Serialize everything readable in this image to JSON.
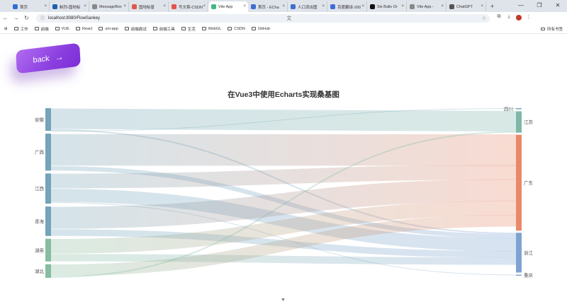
{
  "browser": {
    "tabs": [
      {
        "label": "首页",
        "color": "#2f6fd6"
      },
      {
        "label": "制剂-国地标",
        "color": "#1a5fb4"
      },
      {
        "label": "MessageBox",
        "color": "#888888"
      },
      {
        "label": "国地标普",
        "color": "#e0564b"
      },
      {
        "label": "写文章-CSDN",
        "color": "#e5534b"
      },
      {
        "label": "Vite App",
        "color": "#41b883",
        "active": true
      },
      {
        "label": "首页 - ECha",
        "color": "#3b6fd1"
      },
      {
        "label": "人口流出图",
        "color": "#3b6fd1"
      },
      {
        "label": "百度翻译-200",
        "color": "#3b6fd1"
      },
      {
        "label": "Six Balls Or",
        "color": "#111111"
      },
      {
        "label": "Vite App - ",
        "color": "#888888"
      },
      {
        "label": "ChatGPT",
        "color": "#555555"
      }
    ],
    "new_tab": "+",
    "url": "localhost:8080/FlowSankey",
    "bookmarks": [
      "工作",
      "前端",
      "VUE",
      "React",
      "uni-app",
      "前端面试",
      "前端工具",
      "生活",
      "WebGL",
      "CSDN",
      "GitHub"
    ],
    "bookmarks_right": "所有书签"
  },
  "page": {
    "back_label": "back",
    "back_arrow": "→",
    "scroll_indicator": "▼"
  },
  "chart_data": {
    "type": "sankey",
    "title": "在Vue3中使用Echarts实现桑基图",
    "source_nodes": [
      {
        "name": "安徽",
        "value": 30,
        "color": "#73a4b8"
      },
      {
        "name": "广西",
        "value": 49,
        "color": "#73a4b8"
      },
      {
        "name": "江西",
        "value": 40,
        "color": "#73a4b8"
      },
      {
        "name": "青海",
        "value": 39,
        "color": "#73a4b8"
      },
      {
        "name": "湖南",
        "value": 30,
        "color": "#86bca0"
      },
      {
        "name": "湖北",
        "value": 18,
        "color": "#86bca0"
      }
    ],
    "target_nodes": [
      {
        "name": "四川",
        "value": 1,
        "color": "#73a4b8"
      },
      {
        "name": "江苏",
        "value": 30,
        "color": "#7fb7a8"
      },
      {
        "name": "广东",
        "value": 135,
        "color": "#e9896a"
      },
      {
        "name": "浙江",
        "value": 56,
        "color": "#7fa3d1"
      },
      {
        "name": "重庆",
        "value": 1,
        "color": "#7fa3d1"
      }
    ],
    "links": [
      {
        "source": "安徽",
        "target": "江苏",
        "value": 28
      },
      {
        "source": "安徽",
        "target": "浙江",
        "value": 2
      },
      {
        "source": "安徽",
        "target": "四川",
        "value": 1
      },
      {
        "source": "广西",
        "target": "广东",
        "value": 43
      },
      {
        "source": "广西",
        "target": "浙江",
        "value": 6
      },
      {
        "source": "江西",
        "target": "广东",
        "value": 20
      },
      {
        "source": "江西",
        "target": "浙江",
        "value": 18
      },
      {
        "source": "江西",
        "target": "重庆",
        "value": 1
      },
      {
        "source": "青海",
        "target": "广东",
        "value": 30
      },
      {
        "source": "青海",
        "target": "浙江",
        "value": 9
      },
      {
        "source": "湖南",
        "target": "广东",
        "value": 20
      },
      {
        "source": "湖南",
        "target": "浙江",
        "value": 10
      },
      {
        "source": "湖北",
        "target": "广东",
        "value": 16
      },
      {
        "source": "湖北",
        "target": "江苏",
        "value": 2
      }
    ]
  }
}
